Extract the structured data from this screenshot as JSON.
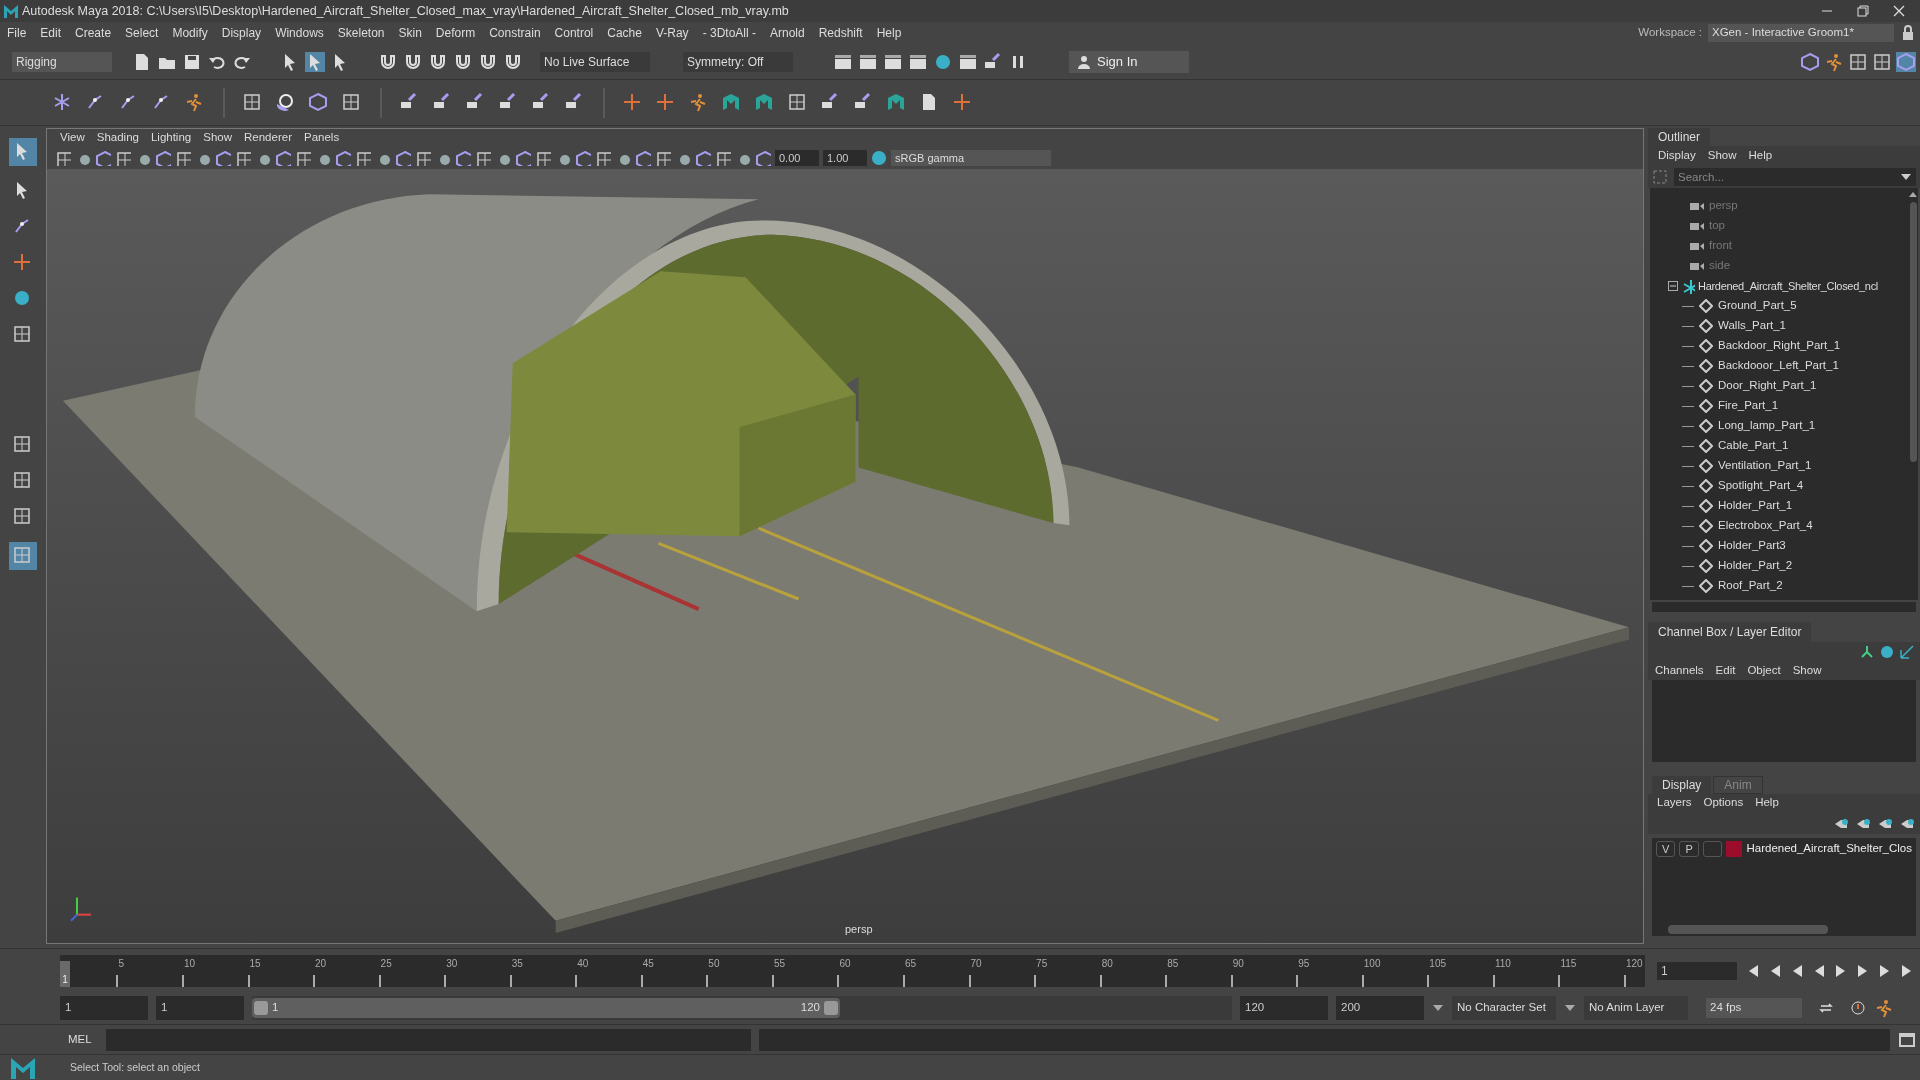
{
  "window": {
    "title": "Autodesk Maya 2018: C:\\Users\\I5\\Desktop\\Hardened_Aircraft_Shelter_Closed_max_vray\\Hardened_Aircraft_Shelter_Closed_mb_vray.mb",
    "workspace_label": "Workspace :",
    "workspace": "XGen - Interactive Groom1*"
  },
  "menu_bar": [
    "File",
    "Edit",
    "Create",
    "Select",
    "Modify",
    "Display",
    "Windows",
    "Skeleton",
    "Skin",
    "Deform",
    "Constrain",
    "Control",
    "Cache",
    "V-Ray",
    "- 3DtoAll -",
    "Arnold",
    "Redshift",
    "Help"
  ],
  "status_line": {
    "menu_set": "Rigging",
    "live_surface": "No Live Surface",
    "symmetry": "Symmetry: Off",
    "sign_in": "Sign In"
  },
  "viewport": {
    "menu": [
      "View",
      "Shading",
      "Lighting",
      "Show",
      "Renderer",
      "Panels"
    ],
    "exposure": "0.00",
    "gamma": "1.00",
    "color_space": "sRGB gamma",
    "camera_label": "persp"
  },
  "outliner": {
    "title": "Outliner",
    "menu": [
      "Display",
      "Show",
      "Help"
    ],
    "search": {
      "placeholder": "Search..."
    },
    "items": [
      {
        "label": "persp",
        "kind": "camera"
      },
      {
        "label": "top",
        "kind": "camera"
      },
      {
        "label": "front",
        "kind": "camera"
      },
      {
        "label": "side",
        "kind": "camera"
      },
      {
        "label": "Hardened_Aircraft_Shelter_Closed_ncl",
        "kind": "group",
        "expanded": true,
        "children": [
          {
            "label": "Ground_Part_5",
            "kind": "mesh"
          },
          {
            "label": "Walls_Part_1",
            "kind": "mesh"
          },
          {
            "label": "Backdoor_Right_Part_1",
            "kind": "mesh"
          },
          {
            "label": "Backdooor_Left_Part_1",
            "kind": "mesh"
          },
          {
            "label": "Door_Right_Part_1",
            "kind": "mesh"
          },
          {
            "label": "Fire_Part_1",
            "kind": "mesh"
          },
          {
            "label": "Long_lamp_Part_1",
            "kind": "mesh"
          },
          {
            "label": "Cable_Part_1",
            "kind": "mesh"
          },
          {
            "label": "Ventilation_Part_1",
            "kind": "mesh"
          },
          {
            "label": "Spotlight_Part_4",
            "kind": "mesh"
          },
          {
            "label": "Holder_Part_1",
            "kind": "mesh"
          },
          {
            "label": "Electrobox_Part_4",
            "kind": "mesh"
          },
          {
            "label": "Holder_Part3",
            "kind": "mesh"
          },
          {
            "label": "Holder_Part_2",
            "kind": "mesh"
          },
          {
            "label": "Roof_Part_2",
            "kind": "mesh"
          }
        ]
      }
    ]
  },
  "channel_box": {
    "title": "Channel Box / Layer Editor",
    "menu": [
      "Channels",
      "Edit",
      "Object",
      "Show"
    ]
  },
  "layer_editor": {
    "tabs": [
      {
        "label": "Display",
        "selected": true
      },
      {
        "label": "Anim",
        "selected": false
      }
    ],
    "menu": [
      "Layers",
      "Options",
      "Help"
    ],
    "layers": [
      {
        "visibility": "V",
        "playback": "P",
        "color": "#9b0d2a",
        "name": "Hardened_Aircraft_Shelter_Clos"
      }
    ]
  },
  "timeline": {
    "current_frame": "1",
    "level": 0,
    "frame_field": "1",
    "ticks": [
      "5",
      "10",
      "15",
      "20",
      "25",
      "30",
      "35",
      "40",
      "45",
      "50",
      "55",
      "60",
      "65",
      "70",
      "75",
      "80",
      "85",
      "90",
      "95",
      "100",
      "105",
      "110",
      "115",
      "120"
    ]
  },
  "range": {
    "level": 0.6,
    "start": "1",
    "playback_start": "1",
    "slider_start": "1",
    "slider_end": "120",
    "playback_end": "120",
    "end": "200",
    "character_set": "No Character Set",
    "anim_layer": "No Anim Layer",
    "fps": "24 fps"
  },
  "command_line": {
    "language": "MEL"
  },
  "help_line": "Select Tool: select an object"
}
